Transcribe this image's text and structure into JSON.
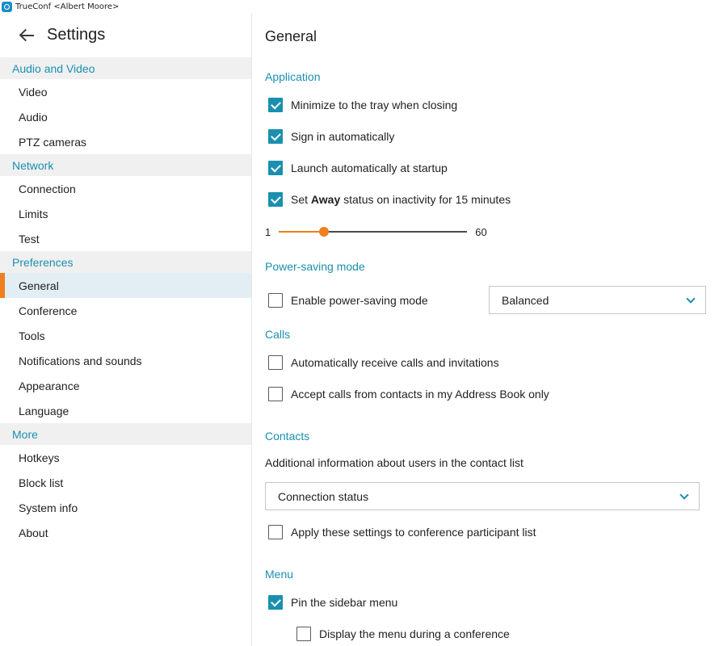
{
  "window": {
    "title": "TrueConf <Albert Moore>"
  },
  "sidebar": {
    "title": "Settings",
    "sections": [
      {
        "label": "Audio and Video",
        "items": [
          "Video",
          "Audio",
          "PTZ cameras"
        ]
      },
      {
        "label": "Network",
        "items": [
          "Connection",
          "Limits",
          "Test"
        ]
      },
      {
        "label": "Preferences",
        "items": [
          "General",
          "Conference",
          "Tools",
          "Notifications and sounds",
          "Appearance",
          "Language"
        ]
      },
      {
        "label": "More",
        "items": [
          "Hotkeys",
          "Block list",
          "System info",
          "About"
        ]
      }
    ],
    "active_item": "General"
  },
  "main": {
    "title": "General",
    "application": {
      "title": "Application",
      "minimize_tray": {
        "label": "Minimize to the tray when closing",
        "checked": true
      },
      "sign_in_auto": {
        "label": "Sign in automatically",
        "checked": true
      },
      "launch_startup": {
        "label": "Launch automatically at startup",
        "checked": true
      },
      "away_status": {
        "prefix": "Set ",
        "bold": "Away",
        "suffix": " status on inactivity for 15 minutes",
        "checked": true
      },
      "slider": {
        "min": "1",
        "max": "60",
        "value": 15
      }
    },
    "power": {
      "title": "Power-saving mode",
      "enable": {
        "label": "Enable power-saving mode",
        "checked": false
      },
      "mode_select": "Balanced"
    },
    "calls": {
      "title": "Calls",
      "auto_receive": {
        "label": "Automatically receive calls and invitations",
        "checked": false
      },
      "address_book_only": {
        "label": "Accept calls from contacts in my Address Book only",
        "checked": false
      }
    },
    "contacts": {
      "title": "Contacts",
      "description": "Additional information about users in the contact list",
      "info_select": "Connection status",
      "apply_conf": {
        "label": "Apply these settings to conference participant list",
        "checked": false
      }
    },
    "menu": {
      "title": "Menu",
      "pin_sidebar": {
        "label": "Pin the sidebar menu",
        "checked": true
      },
      "display_in_conf": {
        "label": "Display the menu during a conference",
        "checked": false
      }
    }
  },
  "colors": {
    "accent": "#1a8fb0",
    "highlight": "#f07f1d",
    "active_bg": "#e2eef3",
    "section_bg": "#f0f0f0"
  }
}
